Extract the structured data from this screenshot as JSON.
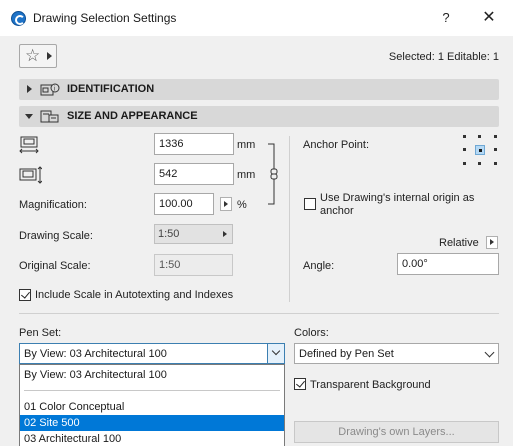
{
  "window": {
    "title": "Drawing Selection Settings",
    "help_label": "?",
    "close_label": "✕"
  },
  "favorites": {
    "star_glyph": "☆"
  },
  "selection_info": "Selected: 1 Editable: 1",
  "sections": {
    "identification": {
      "label": "IDENTIFICATION",
      "expanded": false
    },
    "size_appearance": {
      "label": "SIZE AND APPEARANCE",
      "expanded": true
    }
  },
  "size": {
    "width_value": "1336",
    "width_unit": "mm",
    "height_value": "542",
    "height_unit": "mm",
    "magnification_label": "Magnification:",
    "magnification_value": "100.00",
    "magnification_unit": "%",
    "drawing_scale_label": "Drawing Scale:",
    "drawing_scale_value": "1:50",
    "original_scale_label": "Original Scale:",
    "original_scale_value": "1:50",
    "include_scale_label": "Include Scale in Autotexting and Indexes",
    "include_scale_checked": true
  },
  "anchor": {
    "label": "Anchor Point:",
    "use_origin_label_line1": "Use Drawing's internal origin as",
    "use_origin_label_line2": "anchor",
    "use_origin_checked": false,
    "relative_label": "Relative",
    "angle_label": "Angle:",
    "angle_value": "0.00°"
  },
  "pen_set": {
    "label": "Pen Set:",
    "selected": "By View: 03 Architectural 100",
    "options": [
      {
        "label": "By View: 03 Architectural 100",
        "highlighted": false
      },
      {
        "label": "01 Color Conceptual",
        "highlighted": false
      },
      {
        "label": "02 Site 500",
        "highlighted": true
      },
      {
        "label": "03 Architectural 100",
        "highlighted": false
      }
    ]
  },
  "colors": {
    "label": "Colors:",
    "selected": "Defined by Pen Set",
    "transparent_bg_label": "Transparent Background",
    "transparent_bg_checked": true
  },
  "layers_button_label": "Drawing's own Layers...",
  "icons": {
    "app": "archicad-app-icon",
    "favorites": "star-icon",
    "identification": "id-tag-icon",
    "size_appearance": "size-appearance-icon",
    "width": "width-dimension-icon",
    "height": "height-dimension-icon",
    "link": "chain-link-icon",
    "anchor": "anchor-grid-icon"
  },
  "colors_theme": {
    "section_bg": "#d8d8d8",
    "highlight": "#0078d7",
    "anchor_center": "#b5d9f5"
  }
}
